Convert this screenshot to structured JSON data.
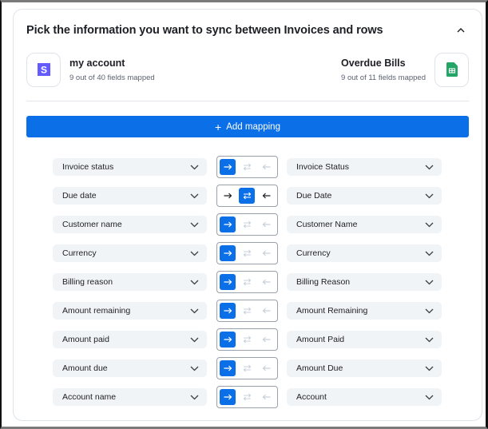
{
  "card": {
    "title": "Pick the information you want to sync between Invoices and rows",
    "collapse_icon": "chevron-up-icon"
  },
  "source_app": {
    "name": "my account",
    "subtitle": "9 out of 40 fields mapped",
    "icon": "stripe-logo-icon",
    "color": "#635bff"
  },
  "target_app": {
    "name": "Overdue Bills",
    "subtitle": "9 out of 11 fields mapped",
    "icon": "google-sheets-logo-icon",
    "color": "#23a566"
  },
  "add_mapping": {
    "label": "Add mapping",
    "icon": "plus-icon"
  },
  "colors": {
    "accent": "#0b6fe8",
    "field_bg": "#f1f4f7",
    "inactive_icon": "#c9d0da"
  },
  "direction_options": [
    "to-target",
    "two-way",
    "to-source"
  ],
  "mappings": [
    {
      "source": "Invoice status",
      "target": "Invoice Status",
      "direction": "to-target"
    },
    {
      "source": "Due date",
      "target": "Due Date",
      "direction": "two-way"
    },
    {
      "source": "Customer name",
      "target": "Customer Name",
      "direction": "to-target"
    },
    {
      "source": "Currency",
      "target": "Currency",
      "direction": "to-target"
    },
    {
      "source": "Billing reason",
      "target": "Billing Reason",
      "direction": "to-target"
    },
    {
      "source": "Amount remaining",
      "target": "Amount Remaining",
      "direction": "to-target"
    },
    {
      "source": "Amount paid",
      "target": "Amount Paid",
      "direction": "to-target"
    },
    {
      "source": "Amount due",
      "target": "Amount Due",
      "direction": "to-target"
    },
    {
      "source": "Account name",
      "target": "Account",
      "direction": "to-target"
    }
  ]
}
